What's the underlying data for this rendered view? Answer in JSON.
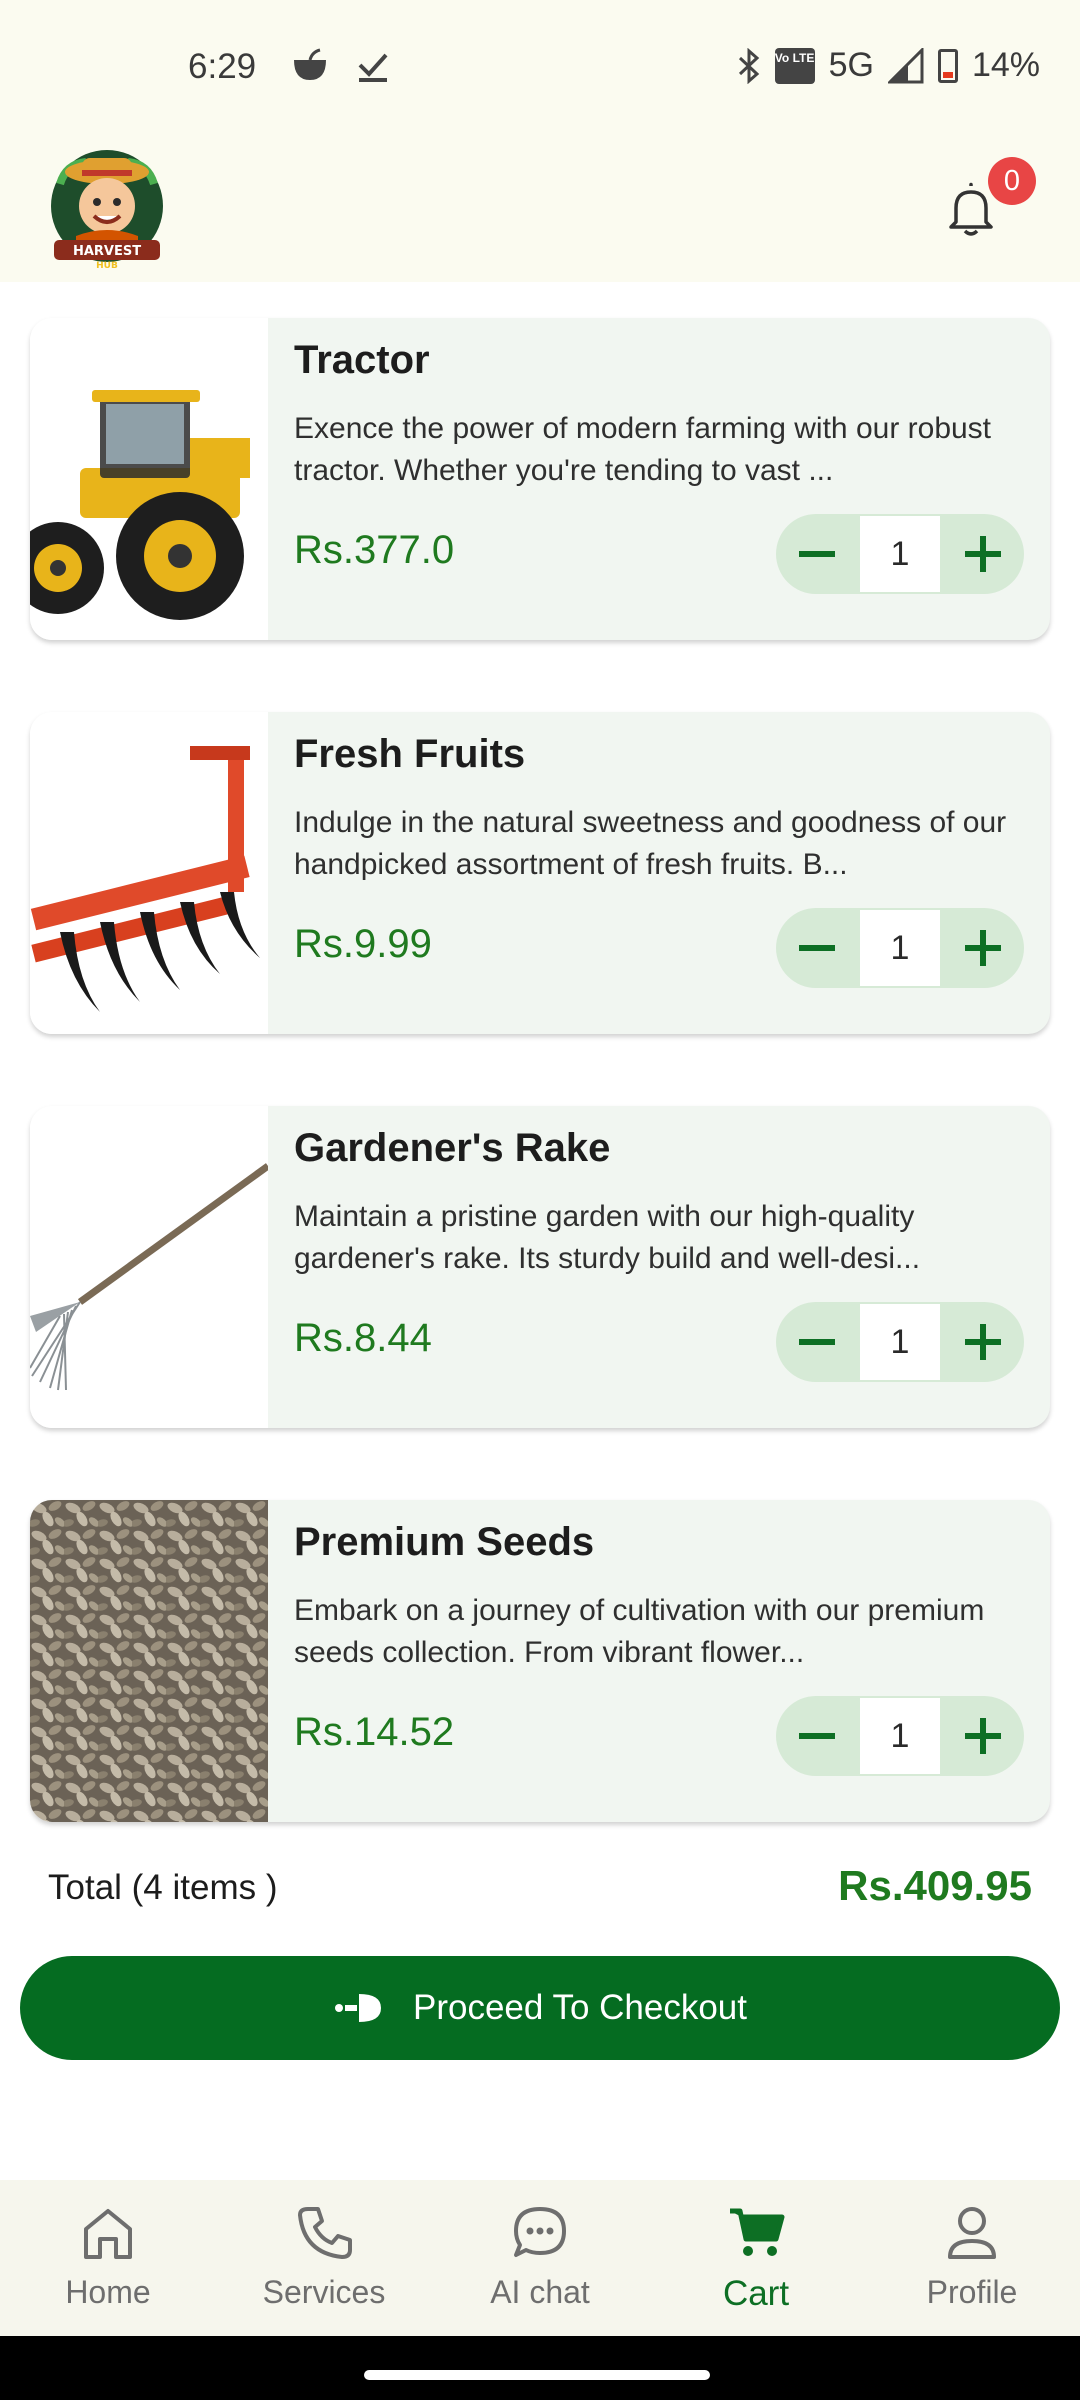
{
  "status_bar": {
    "time": "6:29",
    "network": "5G",
    "battery": "14%",
    "volte_label": "Vo LTE"
  },
  "header": {
    "logo_text": "HARVEST HUB",
    "notification_count": "0",
    "bell_icon": "bell-icon"
  },
  "cart_items": [
    {
      "title": "Tractor",
      "description": "Exence the power of modern farming with our robust tractor. Whether you're tending to vast ...",
      "price": "Rs.377.0",
      "quantity": "1",
      "image": "tractor-image"
    },
    {
      "title": "Fresh Fruits",
      "description": "Indulge in the natural sweetness and goodness of our handpicked assortment of fresh fruits. B...",
      "price": "Rs.9.99",
      "quantity": "1",
      "image": "cultivator-image"
    },
    {
      "title": "Gardener's Rake",
      "description": "Maintain a pristine garden with our high-quality gardener's rake. Its sturdy build and well-desi...",
      "price": "Rs.8.44",
      "quantity": "1",
      "image": "rake-image"
    },
    {
      "title": "Premium Seeds",
      "description": "Embark on a journey of cultivation with our premium seeds collection. From vibrant flower...",
      "price": "Rs.14.52",
      "quantity": "1",
      "image": "seeds-image"
    }
  ],
  "summary": {
    "total_label": "Total (4 items )",
    "total_value": "Rs.409.95"
  },
  "checkout": {
    "label": "Proceed To Checkout",
    "icon": "checkout-arrow-icon"
  },
  "bottom_nav": {
    "items": [
      {
        "label": "Home",
        "icon": "home-icon"
      },
      {
        "label": "Services",
        "icon": "phone-icon"
      },
      {
        "label": "AI chat",
        "icon": "chat-bubble-icon"
      },
      {
        "label": "Cart",
        "icon": "cart-icon",
        "active": true
      },
      {
        "label": "Profile",
        "icon": "person-icon"
      }
    ]
  },
  "colors": {
    "primary_green": "#056c21",
    "price_green": "#1f7a1f",
    "card_bg": "#f1f6f1",
    "header_bg": "#fbfbf0",
    "badge_red": "#e84545"
  }
}
